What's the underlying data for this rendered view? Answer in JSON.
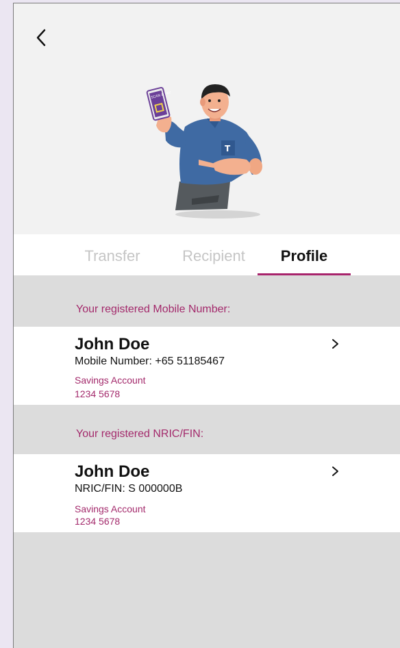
{
  "tabs": [
    {
      "label": "Transfer"
    },
    {
      "label": "Recipient"
    },
    {
      "label": "Profile"
    }
  ],
  "illustration": {
    "card_text": "SCAN & PAY"
  },
  "mobile_section": {
    "label": "Your registered Mobile Number:",
    "card": {
      "name": "John Doe",
      "info": "Mobile Number: +65  51185467",
      "account_type": "Savings Account",
      "account_number": "1234 5678"
    }
  },
  "nric_section": {
    "label": "Your registered NRIC/FIN:",
    "card": {
      "name": "John Doe",
      "info": "NRIC/FIN:  S 000000B",
      "account_type": "Savings Account",
      "account_number": "1234 5678"
    }
  },
  "colors": {
    "accent": "#a8246c",
    "background": "#dcdcdc"
  }
}
